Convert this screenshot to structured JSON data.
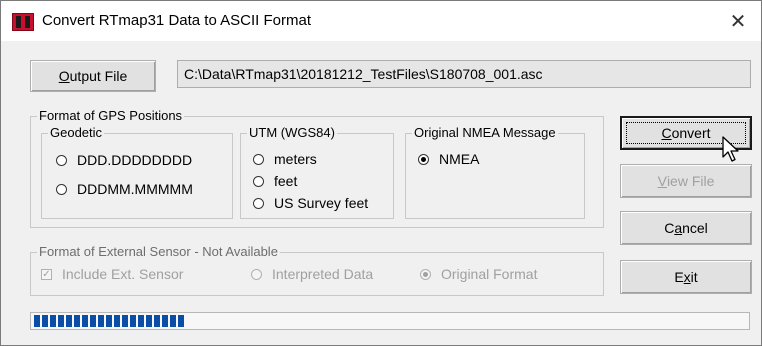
{
  "window": {
    "title": "Convert RTmap31 Data to ASCII Format",
    "close_glyph": "✕"
  },
  "output": {
    "button_label_parts": [
      "O",
      "utput File"
    ],
    "path": "C:\\Data\\RTmap31\\20181212_TestFiles\\S180708_001.asc"
  },
  "gps_format": {
    "label": "Format of GPS Positions",
    "geodetic": {
      "label": "Geodetic",
      "options": [
        "DDD.DDDDDDDD",
        "DDDMM.MMMMM"
      ]
    },
    "utm": {
      "label": "UTM (WGS84)",
      "options": [
        "meters",
        "feet",
        "US Survey feet"
      ]
    },
    "nmea": {
      "label": "Original NMEA Message",
      "options": [
        "NMEA"
      ],
      "selected": "NMEA"
    }
  },
  "external_sensor": {
    "label": "Format of External Sensor - Not Available",
    "include_label": "Include Ext. Sensor",
    "include_checked": true,
    "options": [
      "Interpreted Data",
      "Original Format"
    ],
    "selected": "Original Format"
  },
  "buttons": {
    "convert": [
      "C",
      "onvert"
    ],
    "view_file": [
      "V",
      "iew File"
    ],
    "cancel": [
      "C",
      "a",
      "ncel"
    ],
    "exit": [
      "E",
      "x",
      "it"
    ]
  },
  "progress": {
    "fraction": 0.23,
    "segments": 19
  },
  "colors": {
    "accent": "#0b4ea8",
    "icon_red": "#c8102e"
  },
  "icons": {
    "app": "rtmap-app-icon",
    "cursor": "mouse-pointer-icon"
  }
}
